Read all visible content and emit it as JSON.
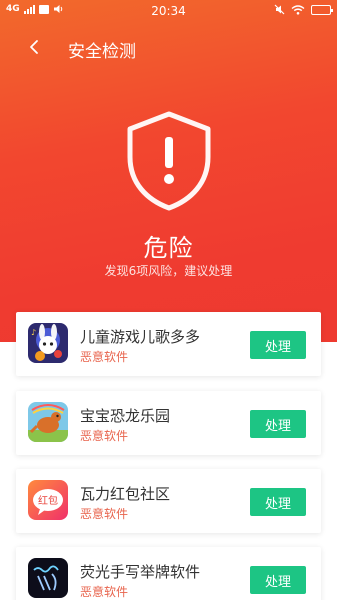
{
  "status_bar": {
    "network": "4G",
    "time": "20:34"
  },
  "header": {
    "title": "安全检测"
  },
  "result": {
    "status_title": "危险",
    "summary": "发现6项风险，建议处理"
  },
  "apps": [
    {
      "name": "儿童游戏儿歌多多",
      "tag": "恶意软件",
      "action": "处理",
      "icon": "kids-rabbit-app-icon"
    },
    {
      "name": "宝宝恐龙乐园",
      "tag": "恶意软件",
      "action": "处理",
      "icon": "dinosaur-app-icon"
    },
    {
      "name": "瓦力红包社区",
      "tag": "恶意软件",
      "action": "处理",
      "icon": "red-envelope-app-icon"
    },
    {
      "name": "荧光手写举牌软件",
      "tag": "恶意软件",
      "action": "处理",
      "icon": "handwriting-app-icon"
    }
  ],
  "colors": {
    "hero_gradient_start": "#f26a2c",
    "hero_gradient_end": "#ee3a30",
    "action_button": "#1dc584",
    "warning_tag": "#e8644d"
  }
}
